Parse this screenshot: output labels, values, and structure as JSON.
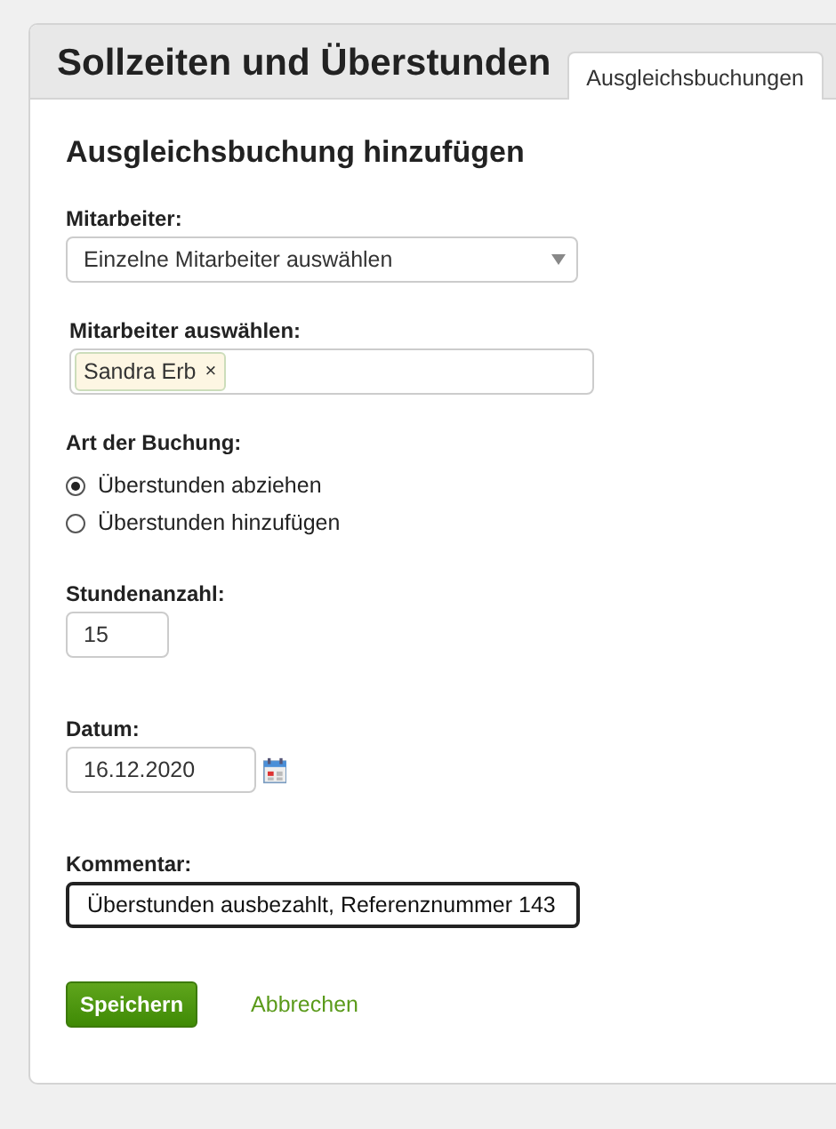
{
  "page_title": "Sollzeiten und Überstunden",
  "tabs": [
    {
      "label": "Ausgleichsbuchungen",
      "selected": true
    }
  ],
  "form": {
    "heading": "Ausgleichsbuchung hinzufügen",
    "fields": [
      {
        "kind": "select",
        "label": "Mitarbeiter:",
        "value": "Einzelne Mitarbeiter auswählen"
      },
      {
        "kind": "tags",
        "label": "Mitarbeiter auswählen:",
        "tags": [
          {
            "label": "Sandra Erb",
            "remove": "×"
          }
        ]
      },
      {
        "kind": "radio",
        "label": "Art der Buchung:",
        "options": [
          {
            "label": "Überstunden abziehen",
            "selected": true
          },
          {
            "label": "Überstunden hinzufügen",
            "selected": false
          }
        ]
      },
      {
        "kind": "number",
        "label": "Stundenanzahl:",
        "value": "15",
        "focused": false
      },
      {
        "kind": "date",
        "label": "Datum:",
        "value": "16.12.2020",
        "focused": false
      },
      {
        "kind": "text",
        "label": "Kommentar:",
        "value": "Überstunden ausbezahlt, Referenznummer 143",
        "focused": true
      }
    ],
    "save_button": "Speichern",
    "cancel_link": "Abbrechen"
  }
}
